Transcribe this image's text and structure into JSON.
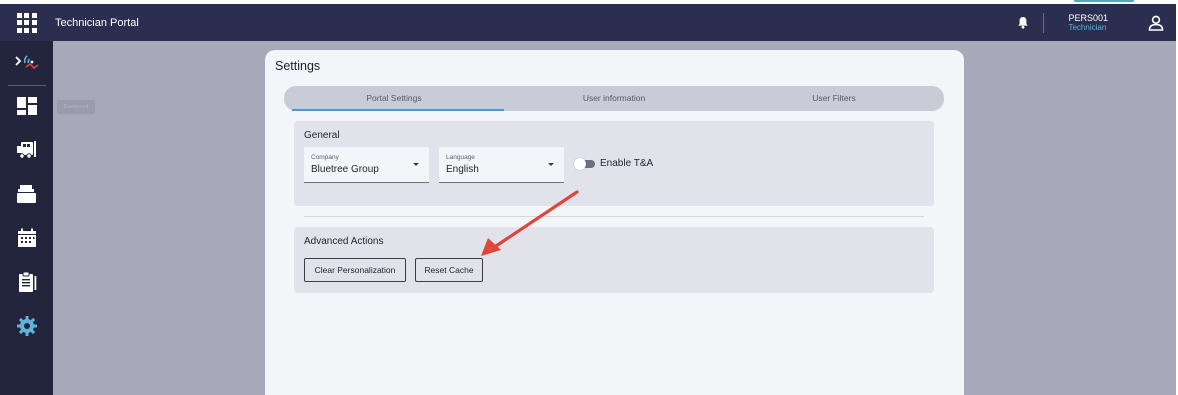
{
  "app": {
    "title": "Technician Portal"
  },
  "header": {
    "user_id": "PERS001",
    "user_role": "Technician",
    "icons": {
      "launcher": "app-launcher-grid-icon",
      "bell": "bell-icon",
      "profile": "user-profile-icon"
    }
  },
  "sidebar": {
    "items": [
      {
        "icon": "signal-expand-icon"
      },
      {
        "icon": "dashboard-icon"
      },
      {
        "icon": "truck-icon"
      },
      {
        "icon": "folder-icon"
      },
      {
        "icon": "calendar-icon"
      },
      {
        "icon": "clipboard-icon"
      },
      {
        "icon": "gear-icon"
      }
    ],
    "tooltip": "Dashboard"
  },
  "settings": {
    "title": "Settings",
    "tabs": [
      {
        "label": "Portal Settings",
        "active": true
      },
      {
        "label": "User information",
        "active": false
      },
      {
        "label": "User Filters",
        "active": false
      }
    ],
    "general": {
      "title": "General",
      "company_label": "Company",
      "company_value": "Bluetree Group",
      "language_label": "Language",
      "language_value": "English",
      "toggle_label": "Enable T&A",
      "toggle_on": false
    },
    "advanced": {
      "title": "Advanced Actions",
      "clear_label": "Clear Personalization",
      "reset_label": "Reset Cache"
    }
  },
  "colors": {
    "header_bg": "#2b2e4f",
    "sidebar_bg": "#22253c",
    "overlay_bg": "#a7a9b8",
    "accent_blue": "#4a9ad0",
    "arrow_red": "#e0453a"
  }
}
